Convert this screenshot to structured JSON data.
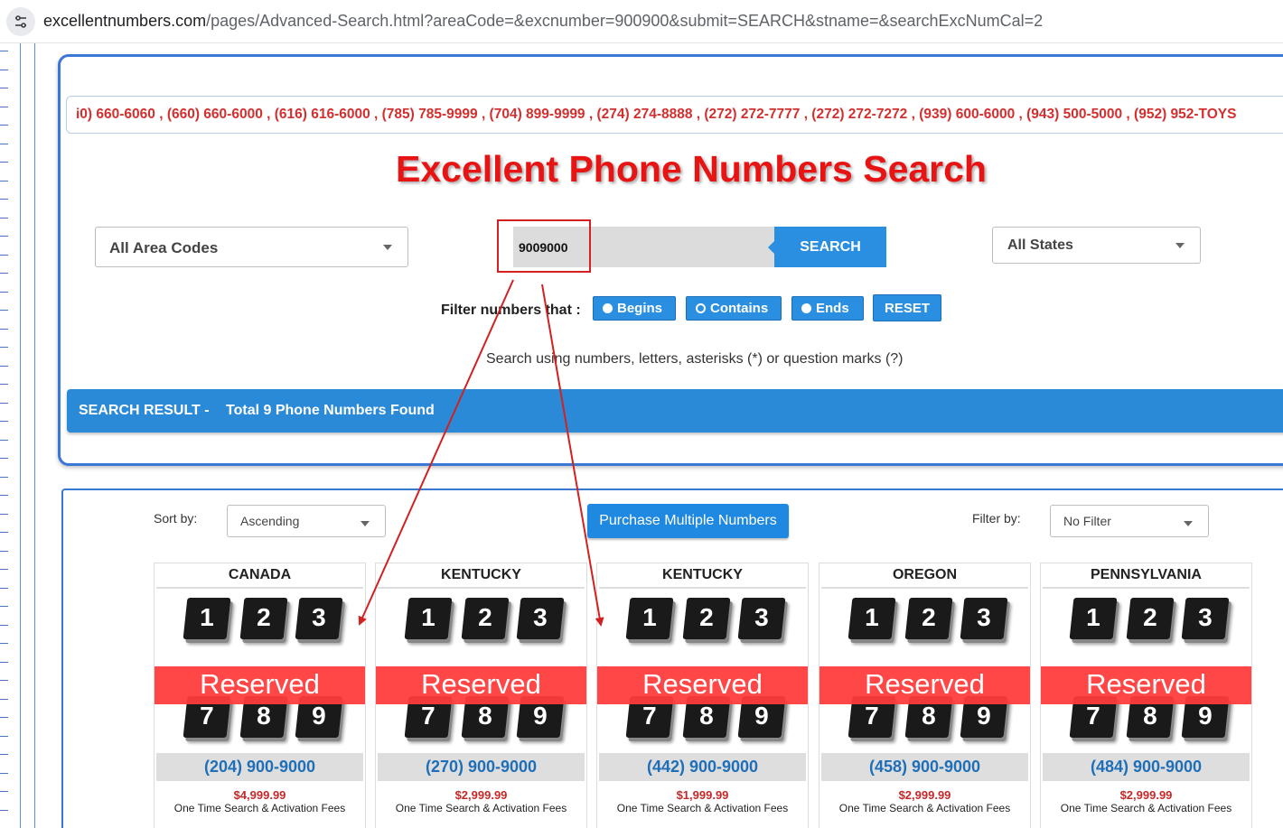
{
  "browser": {
    "url_host": "excellentnumbers.com",
    "url_path": "/pages/Advanced-Search.html?areaCode=&excnumber=900900&submit=SEARCH&stname=&searchExcNumCal=2",
    "site_info_icon": "tune-icon"
  },
  "ticker": {
    "text": "i0) 660-6060 , (660) 660-6000 , (616) 616-6000 , (785) 785-9999 , (704) 899-9999 , (274) 274-8888 , (272) 272-7777 , (272) 272-7272 , (939) 600-6000 , (943) 500-5000 , (952) 952-TOYS"
  },
  "search": {
    "title": "Excellent Phone Numbers Search",
    "area_select": "All Area Codes",
    "input_value": "9009000",
    "search_button": "SEARCH",
    "state_select": "All States",
    "filter_label": "Filter numbers that :",
    "filter_buttons": {
      "begins": "Begins",
      "contains": "Contains",
      "ends": "Ends",
      "reset": "RESET"
    },
    "hint": "Search using numbers, letters, asterisks (*) or question marks (?)"
  },
  "result_bar": {
    "label": "SEARCH RESULT -",
    "summary": "Total 9 Phone Numbers Found"
  },
  "results": {
    "sort_label": "Sort by:",
    "sort_value": "Ascending",
    "purchase_button": "Purchase Multiple Numbers",
    "filter_label": "Filter by:",
    "filter_value": "No Filter",
    "keypad_digits": [
      "1",
      "2",
      "3",
      "7",
      "8",
      "9"
    ],
    "reserved_label": "Reserved",
    "fee_text": "One Time Search & Activation Fees",
    "cards": [
      {
        "state": "CANADA",
        "phone": "(204) 900-9000",
        "price": "$4,999.99"
      },
      {
        "state": "KENTUCKY",
        "phone": "(270) 900-9000",
        "price": "$2,999.99"
      },
      {
        "state": "KENTUCKY",
        "phone": "(442) 900-9000",
        "price": "$1,999.99"
      },
      {
        "state": "OREGON",
        "phone": "(458) 900-9000",
        "price": "$2,999.99"
      },
      {
        "state": "PENNSYLVANIA",
        "phone": "(484) 900-9000",
        "price": "$2,999.99"
      }
    ]
  },
  "colors": {
    "accent_blue": "#2a8fe0",
    "title_red": "#e81414",
    "annotation_red": "#d32020",
    "phone_blue": "#1f6fb8"
  }
}
